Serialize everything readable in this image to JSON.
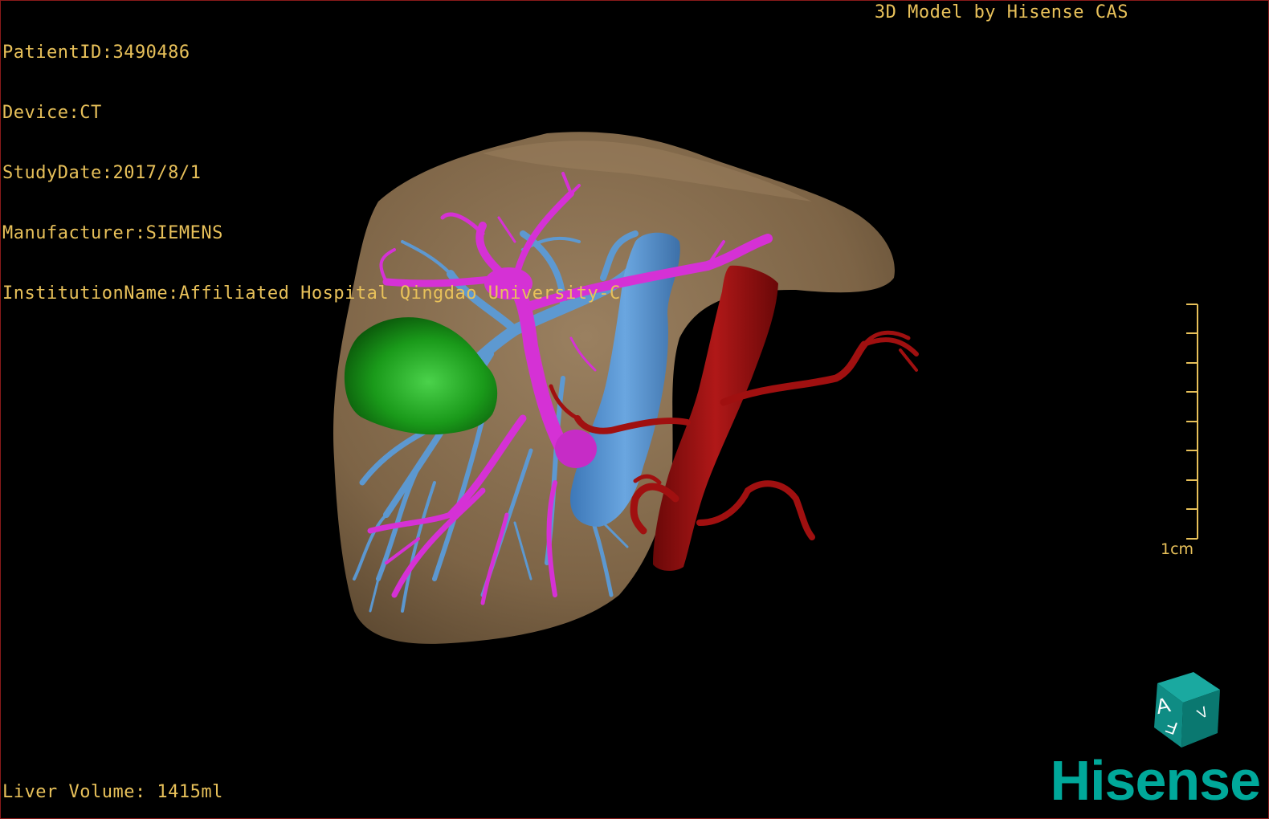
{
  "patient": {
    "patient_id_label": "PatientID:3490486",
    "device_label": "Device:CT",
    "study_date_label": "StudyDate:2017/8/1",
    "manufacturer_label": "Manufacturer:SIEMENS",
    "institution_label": "InstitutionName:Affiliated Hospital Qingdao University-C"
  },
  "credit": "3D Model by Hisense CAS",
  "liver_volume": "Liver Volume: 1415ml",
  "scale_bar": {
    "label": "1cm"
  },
  "orientation_cube": {
    "letters": [
      "A",
      "F",
      "V"
    ]
  },
  "brand": "Hisense",
  "colors": {
    "overlay_text": "#e8c15a",
    "liver": "#8a7150",
    "portal_vein": "#d531d5",
    "hepatic_vein": "#5b9bd8",
    "artery": "#a01010",
    "tumor": "#1aa01a",
    "brand": "#00a89a"
  }
}
